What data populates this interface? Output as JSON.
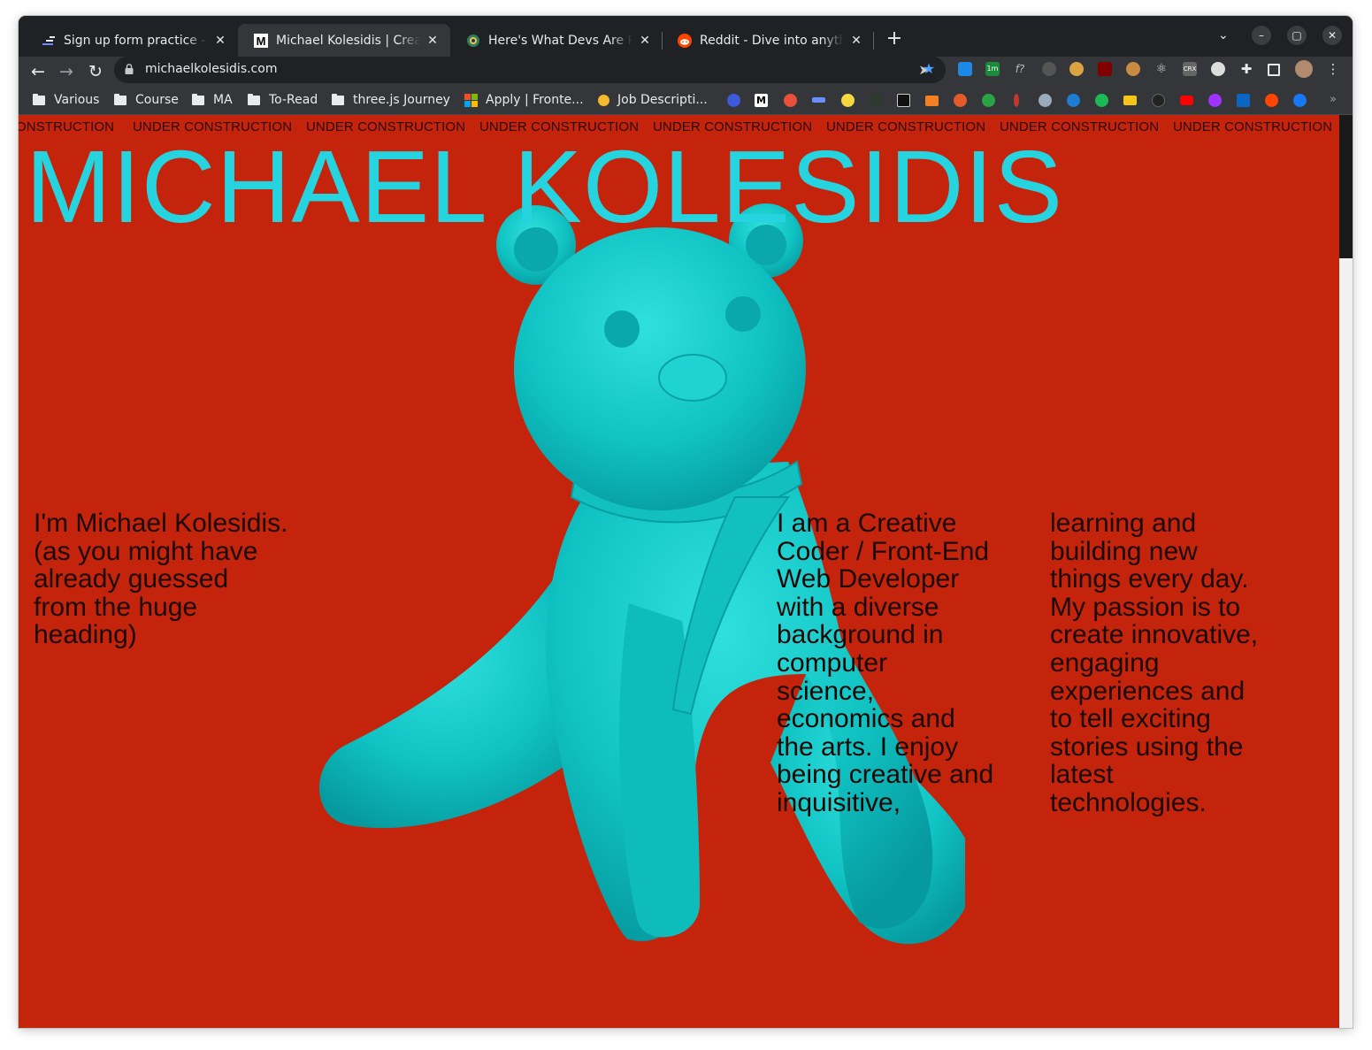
{
  "browser": {
    "tabs": [
      {
        "title": "Sign up form practice - Scrimba",
        "favicon": "scrimba-icon",
        "active": false
      },
      {
        "title": "Michael Kolesidis | Creative Coder",
        "favicon": "m-logo-icon",
        "active": true
      },
      {
        "title": "Here's What Devs Are Planning",
        "favicon": "globe-icon",
        "active": false
      },
      {
        "title": "Reddit - Dive into anything",
        "favicon": "reddit-icon",
        "active": false
      }
    ],
    "url": "michaelkolesidis.com",
    "bookmarks": [
      {
        "label": "Various",
        "icon": "folder-icon"
      },
      {
        "label": "Course",
        "icon": "folder-icon"
      },
      {
        "label": "MA",
        "icon": "folder-icon"
      },
      {
        "label": "To-Read",
        "icon": "folder-icon"
      },
      {
        "label": "three.js Journey",
        "icon": "folder-icon"
      },
      {
        "label": "Apply | Fronte...",
        "icon": "microsoft-icon"
      },
      {
        "label": "Job Descripti...",
        "icon": "smiley-icon"
      }
    ]
  },
  "page": {
    "marquee": [
      "ONSTRUCTION",
      "UNDER CONSTRUCTION",
      "UNDER CONSTRUCTION",
      "UNDER CONSTRUCTION",
      "UNDER CONSTRUCTION",
      "UNDER CONSTRUCTION",
      "UNDER CONSTRUCTION",
      "UNDER CONSTRUCTION"
    ],
    "headline": "MICHAEL KOLESIDIS",
    "intro_lines": [
      "I'm Michael Kolesidis.",
      "(as you might have",
      "already guessed",
      "from the huge",
      "heading)"
    ],
    "about_col1": [
      "I am a Creative",
      "Coder / Front-End",
      "Web Developer",
      "with a diverse",
      "background in",
      "computer",
      "science,",
      "economics and",
      "the arts. I enjoy",
      "being creative and",
      "inquisitive,"
    ],
    "about_col2": [
      "learning and",
      "building new",
      "things every day.",
      "My passion is to",
      "create innovative,",
      "engaging",
      "experiences and",
      "to tell exciting",
      "stories using the",
      "latest",
      "technologies."
    ],
    "colors": {
      "background": "#c4230c",
      "headline": "#26d4df",
      "bear": "#13c6c6",
      "text": "#1b0906"
    }
  }
}
